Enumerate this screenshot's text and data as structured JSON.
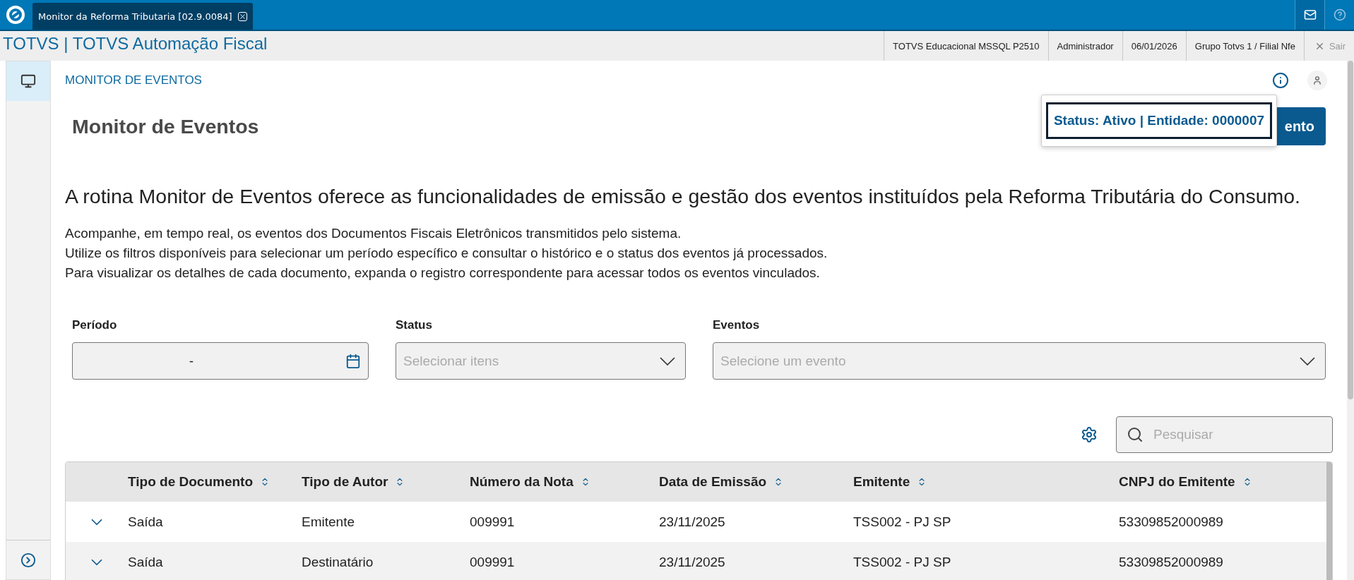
{
  "top_bar": {
    "tab": {
      "title": "Monitor da Reforma Tributaria [02.9.0084]"
    }
  },
  "header": {
    "title": "TOTVS | TOTVS Automação Fiscal",
    "info": [
      "TOTVS Educacional MSSQL P2510",
      "Administrador",
      "06/01/2026",
      "Grupo Totvs 1 / Filial Nfe"
    ],
    "exit": "Sair"
  },
  "sidebar": {
    "items": [
      {
        "selected": true
      }
    ]
  },
  "breadcrumb": "MONITOR DE EVENTOS",
  "page_title": "Monitor de Eventos",
  "action_button": "ento",
  "popover": "Status: Ativo | Entidade: 0000007",
  "intro": "A rotina Monitor de Eventos oferece as funcionalidades de emissão e gestão dos eventos instituídos pela Reforma Tributária do Consumo.",
  "description": [
    "Acompanhe, em tempo real, os eventos dos Documentos Fiscais Eletrônicos transmitidos pelo sistema.",
    "Utilize os filtros disponíveis para selecionar um período específico e consultar o histórico e o status dos eventos já processados.",
    "Para visualizar os detalhes de cada documento, expanda o registro correspondente para acessar todos os eventos vinculados."
  ],
  "filters": [
    {
      "label": "Período",
      "kind": "date",
      "value": "-"
    },
    {
      "label": "Status",
      "kind": "select",
      "placeholder": "Selecionar itens"
    },
    {
      "label": "Eventos",
      "kind": "select",
      "placeholder": "Selecione um evento"
    }
  ],
  "search": {
    "placeholder": "Pesquisar"
  },
  "table": {
    "columns": [
      "Tipo de Documento",
      "Tipo de Autor",
      "Número da Nota",
      "Data de Emissão",
      "Emitente",
      "CNPJ do Emitente"
    ],
    "rows": [
      {
        "expanded": false,
        "cells": [
          "Saída",
          "Emitente",
          "009991",
          "23/11/2025",
          "TSS002 - PJ SP",
          "53309852000989"
        ]
      },
      {
        "expanded": false,
        "cells": [
          "Saída",
          "Destinatário",
          "009991",
          "23/11/2025",
          "TSS002 - PJ SP",
          "53309852000989"
        ]
      }
    ]
  }
}
